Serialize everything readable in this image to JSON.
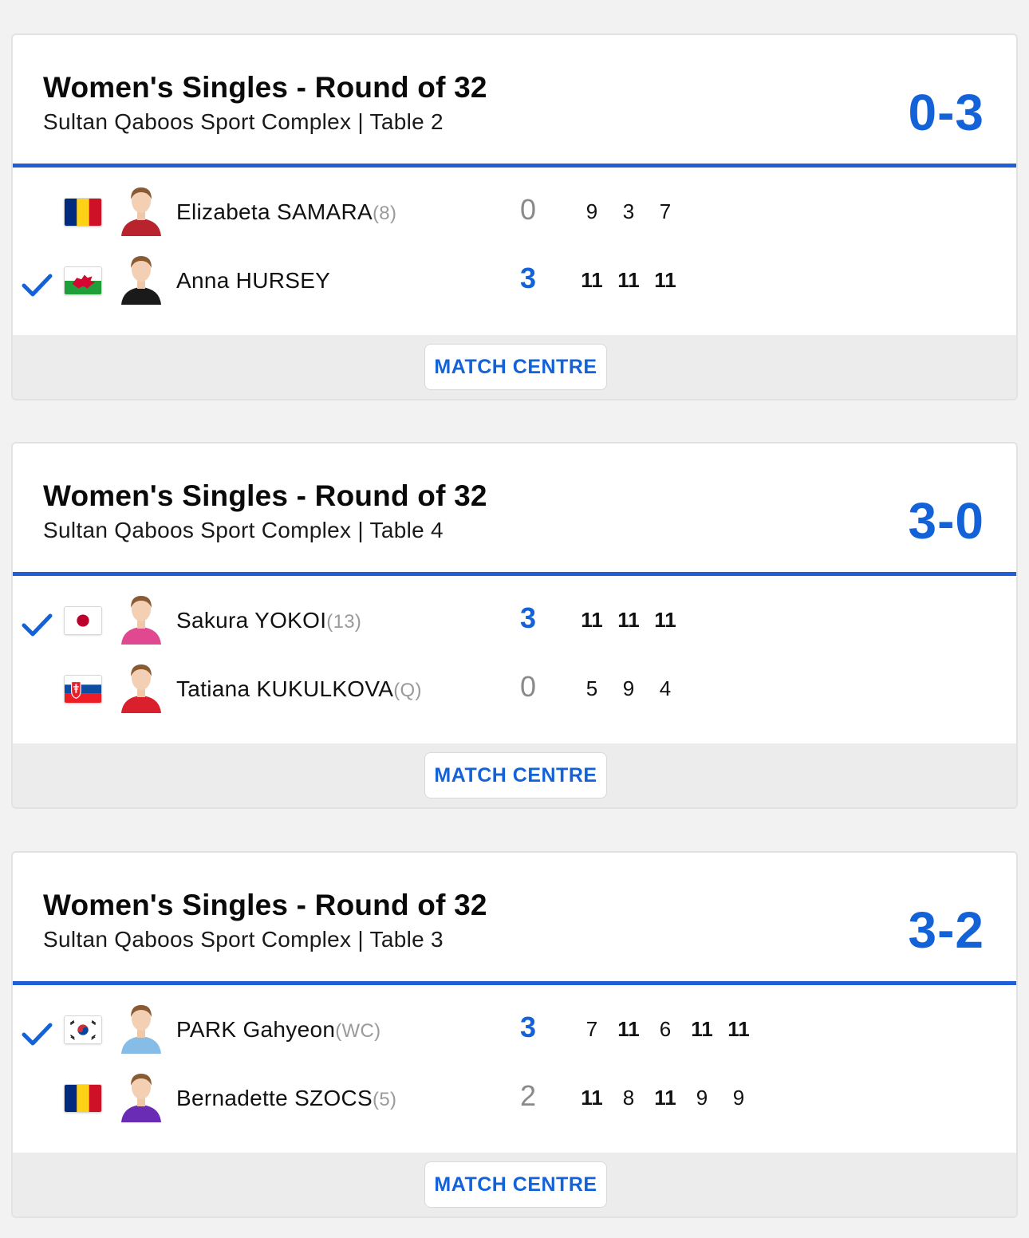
{
  "matches": [
    {
      "title": "Women's Singles - Round of 32",
      "venue": "Sultan Qaboos Sport Complex | Table 2",
      "score": "0-3",
      "button": "MATCH CENTRE",
      "players": [
        {
          "name": "Elizabeta SAMARA",
          "seed": "(8)",
          "flag": "romania-flag",
          "avatar": "player-photo",
          "winner": false,
          "games": "0",
          "sets": [
            "9",
            "3",
            "7"
          ]
        },
        {
          "name": "Anna HURSEY",
          "seed": "",
          "flag": "wales-flag",
          "avatar": "player-photo",
          "winner": true,
          "games": "3",
          "sets": [
            "11",
            "11",
            "11"
          ]
        }
      ]
    },
    {
      "title": "Women's Singles - Round of 32",
      "venue": "Sultan Qaboos Sport Complex | Table 4",
      "score": "3-0",
      "button": "MATCH CENTRE",
      "players": [
        {
          "name": "Sakura YOKOI",
          "seed": "(13)",
          "flag": "japan-flag",
          "avatar": "player-photo",
          "winner": true,
          "games": "3",
          "sets": [
            "11",
            "11",
            "11"
          ]
        },
        {
          "name": "Tatiana KUKULKOVA",
          "seed": "(Q)",
          "flag": "slovakia-flag",
          "avatar": "player-photo",
          "winner": false,
          "games": "0",
          "sets": [
            "5",
            "9",
            "4"
          ]
        }
      ]
    },
    {
      "title": "Women's Singles - Round of 32",
      "venue": "Sultan Qaboos Sport Complex | Table 3",
      "score": "3-2",
      "button": "MATCH CENTRE",
      "players": [
        {
          "name": "PARK Gahyeon",
          "seed": "(WC)",
          "flag": "korea-flag",
          "avatar": "player-photo",
          "winner": true,
          "games": "3",
          "sets": [
            "7",
            "11",
            "6",
            "11",
            "11"
          ]
        },
        {
          "name": "Bernadette SZOCS",
          "seed": "(5)",
          "flag": "romania-flag",
          "avatar": "player-photo",
          "winner": false,
          "games": "2",
          "sets": [
            "11",
            "8",
            "11",
            "9",
            "9"
          ]
        }
      ]
    }
  ],
  "colors": {
    "accent": "#1462d8",
    "header_rule": "#1f5fd6",
    "footer_bg": "#ececec",
    "page_bg": "#f2f2f2",
    "muted": "#8a8a8a",
    "seed": "#9a9a9a"
  },
  "icons": {
    "winner": "check-icon",
    "player": "avatar"
  },
  "jerseys": [
    "#b8232e",
    "#1a1a1a",
    "#e0488f",
    "#d9202c",
    "#86bde6",
    "#6a2bb5"
  ]
}
